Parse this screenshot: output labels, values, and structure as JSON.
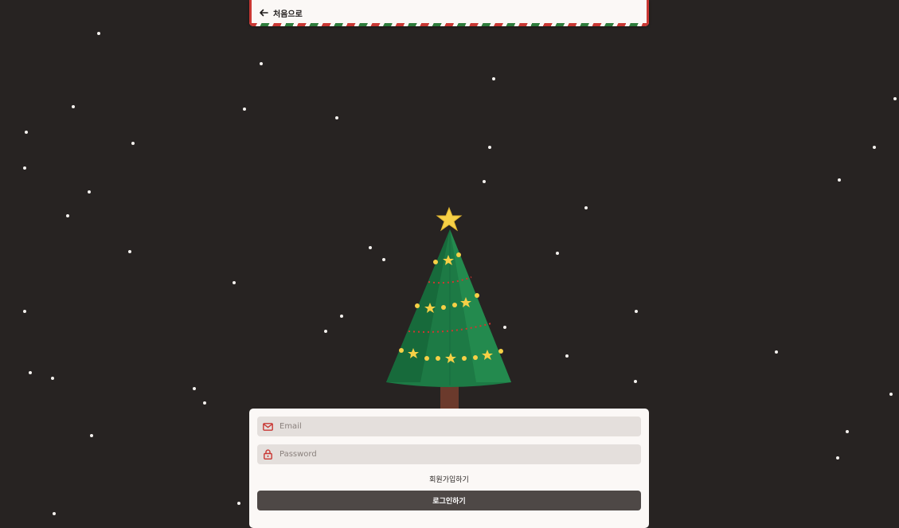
{
  "header": {
    "back_label": "처음으로"
  },
  "login_form": {
    "email_placeholder": "Email",
    "password_placeholder": "Password",
    "signup_link": "회원가입하기",
    "login_button": "로그인하기"
  },
  "colors": {
    "background": "#272322",
    "accent_red": "#c93733",
    "accent_green": "#2e7d3c",
    "tree_green": "#1d7a45",
    "star_yellow": "#f6d046",
    "button_dark": "#4e4846"
  },
  "icons": {
    "back": "arrow-left-icon",
    "email": "mail-icon",
    "password": "lock-icon"
  }
}
